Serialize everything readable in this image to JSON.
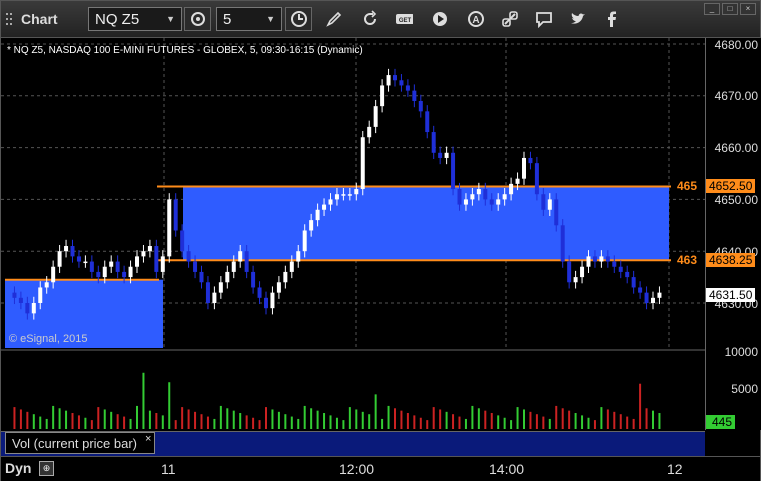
{
  "toolbar": {
    "title": "Chart",
    "symbol": "NQ Z5",
    "interval": "5"
  },
  "legend": "* NQ Z5, NASDAQ 100 E-MINI FUTURES - GLOBEX, 5, 09:30-16:15 (Dynamic)",
  "copyright": "© eSignal, 2015",
  "colors": {
    "up": "#ffffff",
    "down": "#1f2fd8",
    "zone": "#2f5cff",
    "line": "#ff8c1a",
    "vol_up": "#33cc33",
    "vol_down": "#cc2222"
  },
  "price_axis": {
    "labels": [
      "4680.00",
      "4670.00",
      "4660.00",
      "4650.00",
      "4640.00",
      "4630.00"
    ],
    "level_top": {
      "label": "465",
      "tag": "4652.50",
      "value": 4652.5
    },
    "level_bottom": {
      "label": "463",
      "tag": "4638.25",
      "value": 4638.25
    },
    "last": {
      "tag": "4631.50",
      "value": 4631.5
    }
  },
  "volume_axis": {
    "labels": [
      "10000",
      "5000"
    ],
    "last_tag": "445"
  },
  "volume_panel": {
    "label": "Vol (current price bar)",
    "close": "×"
  },
  "time_axis": {
    "labels": [
      "11",
      "12:00",
      "14:00",
      "12"
    ]
  },
  "status": {
    "mode": "Dyn"
  },
  "window_controls": [
    "_",
    "□",
    "×"
  ]
}
